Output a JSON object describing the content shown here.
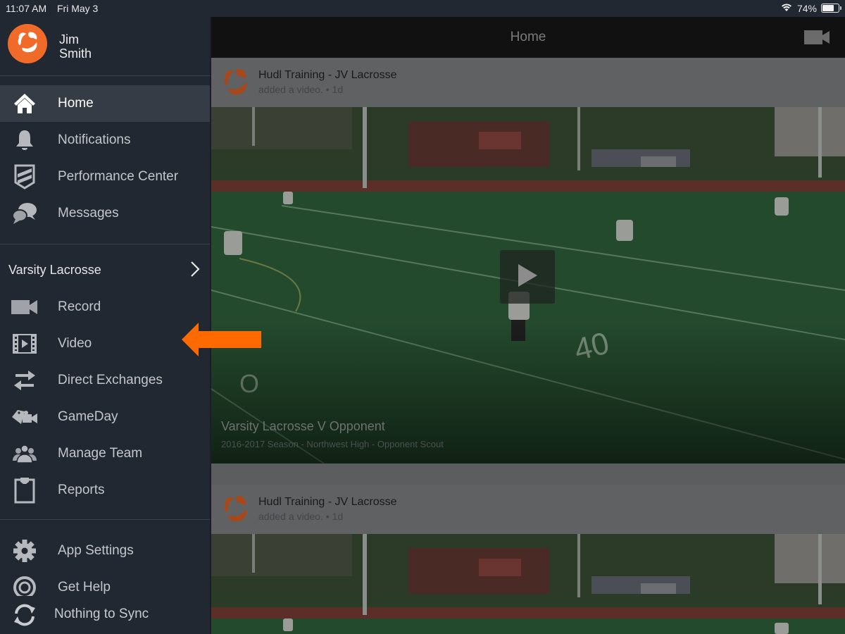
{
  "status_bar": {
    "time": "11:07 AM",
    "date": "Fri May 3",
    "battery_percent_label": "74%",
    "battery_level": 0.74,
    "wifi_icon": "wifi-icon"
  },
  "profile": {
    "first_name": "Jim",
    "last_name": "Smith",
    "avatar_icon": "hudl-logo-icon",
    "brand_color": "#f06a2a"
  },
  "sidebar": {
    "primary_items": [
      {
        "label": "Home",
        "icon": "home-icon",
        "active": true
      },
      {
        "label": "Notifications",
        "icon": "bell-icon",
        "active": false
      },
      {
        "label": "Performance Center",
        "icon": "shield-icon",
        "active": false
      },
      {
        "label": "Messages",
        "icon": "chat-bubbles-icon",
        "active": false
      }
    ],
    "team": {
      "name": "Varsity Lacrosse",
      "chevron_icon": "chevron-right-icon"
    },
    "team_items": [
      {
        "label": "Record",
        "icon": "video-camera-icon"
      },
      {
        "label": "Video",
        "icon": "film-play-icon"
      },
      {
        "label": "Direct Exchanges",
        "icon": "exchange-arrows-icon"
      },
      {
        "label": "GameDay",
        "icon": "tag-camera-icon"
      },
      {
        "label": "Manage Team",
        "icon": "people-icon"
      },
      {
        "label": "Reports",
        "icon": "clipboard-icon"
      }
    ],
    "settings_items": [
      {
        "label": "App Settings",
        "icon": "gear-icon"
      },
      {
        "label": "Get Help",
        "icon": "help-icon"
      }
    ],
    "sync": {
      "label": "Nothing to Sync",
      "icon": "sync-icon"
    }
  },
  "main": {
    "title": "Home",
    "record_icon": "video-camera-icon",
    "feed": [
      {
        "poster": "Hudl Training - JV Lacrosse",
        "action": "added a video.",
        "age": "1d",
        "meta": "added a video. • 1d",
        "video_title": "Varsity Lacrosse V Opponent",
        "video_subtitle": "2016-2017 Season - Northwest High - Opponent Scout"
      },
      {
        "poster": "Hudl Training - JV Lacrosse",
        "action": "added a video.",
        "age": "1d",
        "meta": "added a video. • 1d"
      }
    ]
  },
  "annotation": {
    "arrow_color": "#ff6a00",
    "points_to": "Video"
  }
}
